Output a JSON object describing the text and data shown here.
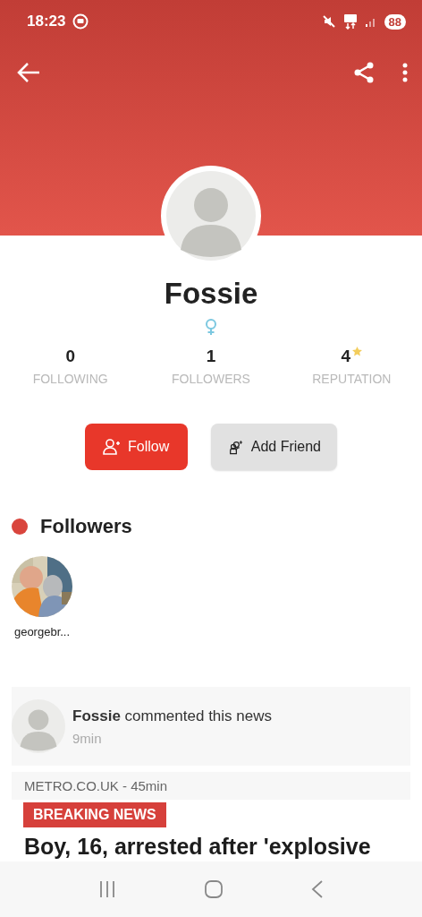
{
  "status_bar": {
    "time": "18:23",
    "battery": "88"
  },
  "profile": {
    "name": "Fossie"
  },
  "stats": [
    {
      "value": "0",
      "label": "FOLLOWING",
      "kind": "plain"
    },
    {
      "value": "1",
      "label": "FOLLOWERS",
      "kind": "plain"
    },
    {
      "value": "4",
      "label": "REPUTATION",
      "kind": "rating"
    }
  ],
  "buttons": [
    {
      "label": "Follow",
      "kind": "primary"
    },
    {
      "label": "Add Friend",
      "kind": "secondary"
    }
  ],
  "followers_section": {
    "title": "Followers",
    "followers": [
      {
        "name": "georgebr..."
      }
    ]
  },
  "activity": {
    "user": "Fossie",
    "action": "commented this news",
    "time": "9min"
  },
  "news": {
    "source": "METRO.CO.UK",
    "time": "- 45min",
    "badge": "BREAKING NEWS",
    "headline": "Boy, 16, arrested after 'explosive"
  }
}
